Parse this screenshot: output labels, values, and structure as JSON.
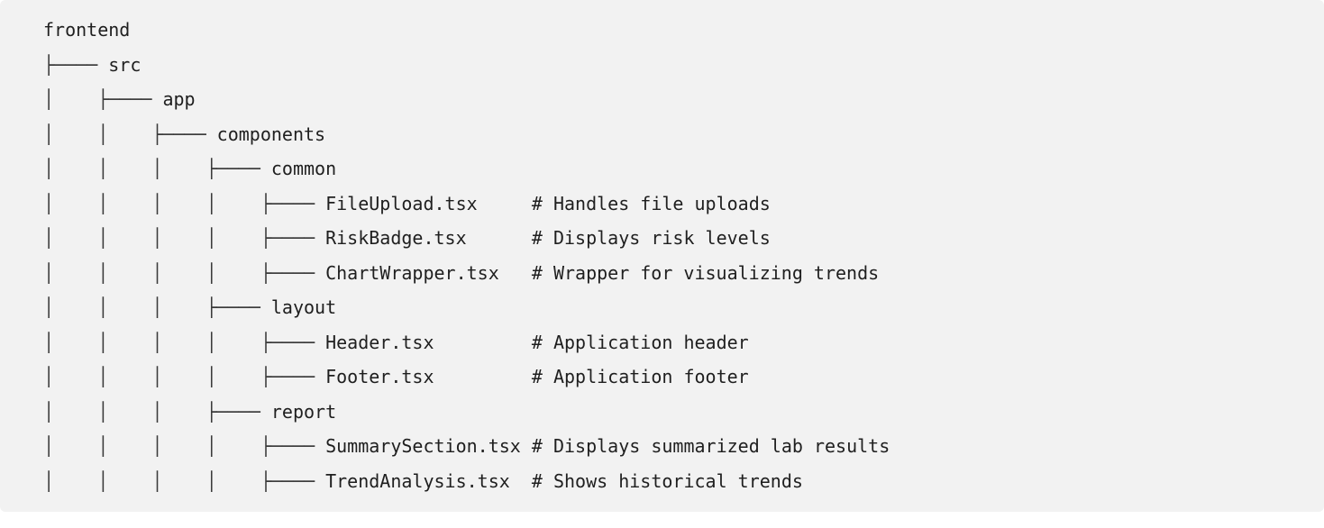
{
  "tree": {
    "lines": [
      {
        "prefix": "",
        "name": "frontend",
        "pad": "",
        "comment": ""
      },
      {
        "prefix": "├──── ",
        "name": "src",
        "pad": "",
        "comment": ""
      },
      {
        "prefix": "│    ├──── ",
        "name": "app",
        "pad": "",
        "comment": ""
      },
      {
        "prefix": "│    │    ├──── ",
        "name": "components",
        "pad": "",
        "comment": ""
      },
      {
        "prefix": "│    │    │    ├──── ",
        "name": "common",
        "pad": "",
        "comment": ""
      },
      {
        "prefix": "│    │    │    │    ├──── ",
        "name": "FileUpload.tsx",
        "pad": "     ",
        "comment": "# Handles file uploads"
      },
      {
        "prefix": "│    │    │    │    ├──── ",
        "name": "RiskBadge.tsx",
        "pad": "      ",
        "comment": "# Displays risk levels"
      },
      {
        "prefix": "│    │    │    │    ├──── ",
        "name": "ChartWrapper.tsx",
        "pad": "   ",
        "comment": "# Wrapper for visualizing trends"
      },
      {
        "prefix": "│    │    │    ├──── ",
        "name": "layout",
        "pad": "",
        "comment": ""
      },
      {
        "prefix": "│    │    │    │    ├──── ",
        "name": "Header.tsx",
        "pad": "         ",
        "comment": "# Application header"
      },
      {
        "prefix": "│    │    │    │    ├──── ",
        "name": "Footer.tsx",
        "pad": "         ",
        "comment": "# Application footer"
      },
      {
        "prefix": "│    │    │    ├──── ",
        "name": "report",
        "pad": "",
        "comment": ""
      },
      {
        "prefix": "│    │    │    │    ├──── ",
        "name": "SummarySection.tsx",
        "pad": " ",
        "comment": "# Displays summarized lab results"
      },
      {
        "prefix": "│    │    │    │    ├──── ",
        "name": "TrendAnalysis.tsx",
        "pad": "  ",
        "comment": "# Shows historical trends"
      }
    ]
  }
}
